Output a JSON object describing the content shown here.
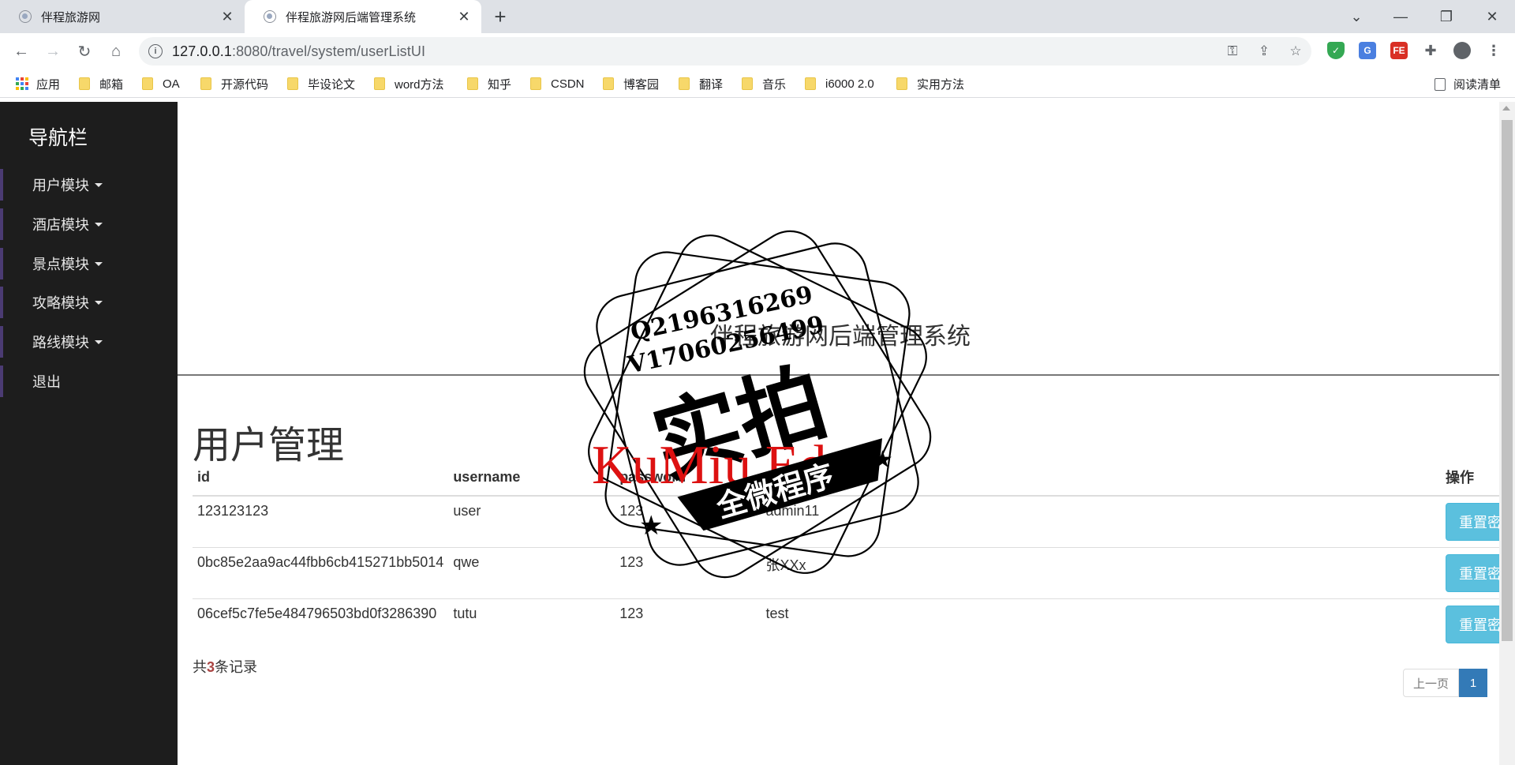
{
  "browser": {
    "tabs": [
      {
        "title": "伴程旅游网",
        "active": false
      },
      {
        "title": "伴程旅游网后端管理系统",
        "active": true
      }
    ],
    "url_host": "127.0.0.1",
    "url_path": ":8080/travel/system/userListUI",
    "bookmarks": [
      "应用",
      "邮箱",
      "OA",
      "开源代码",
      "毕设论文",
      "word方法",
      "知乎",
      "CSDN",
      "博客园",
      "翻译",
      "音乐",
      "i6000 2.0",
      "实用方法"
    ],
    "reading_list": "阅读清单",
    "ext_fe": "FE",
    "ext_g": "G"
  },
  "sidebar": {
    "brand": "导航栏",
    "items": [
      "用户模块",
      "酒店模块",
      "景点模块",
      "攻略模块",
      "路线模块",
      "退出"
    ]
  },
  "header": {
    "site_title": "伴程旅游网后端管理系统"
  },
  "main": {
    "heading": "用户管理",
    "columns": [
      "id",
      "username",
      "password",
      "",
      "操作"
    ],
    "rows": [
      {
        "id": "123123123",
        "username": "user",
        "password": "123",
        "name": "admin11",
        "action": "重置密码"
      },
      {
        "id": "0bc85e2aa9ac44fbb6cb415271bb5014",
        "username": "qwe",
        "password": "123",
        "name": "张XXx",
        "action": "重置密码"
      },
      {
        "id": "06cef5c7fe5e484796503bd0f3286390",
        "username": "tutu",
        "password": "123",
        "name": "test",
        "action": "重置密码"
      }
    ],
    "record_prefix": "共",
    "record_count": "3",
    "record_suffix": "条记录",
    "pagination": {
      "prev": "上一页",
      "current": "1"
    }
  },
  "watermark": {
    "line1": "Q2196316269",
    "line2": "V17060256499",
    "big": "实拍",
    "ribbon": "全微程序",
    "red": "KuMiu Edu"
  },
  "colors": {
    "sidebar_bg": "#1d1d1d",
    "sidebar_accent": "#4b3b73",
    "info_button": "#5bc0de",
    "pagination_active": "#337ab7"
  }
}
